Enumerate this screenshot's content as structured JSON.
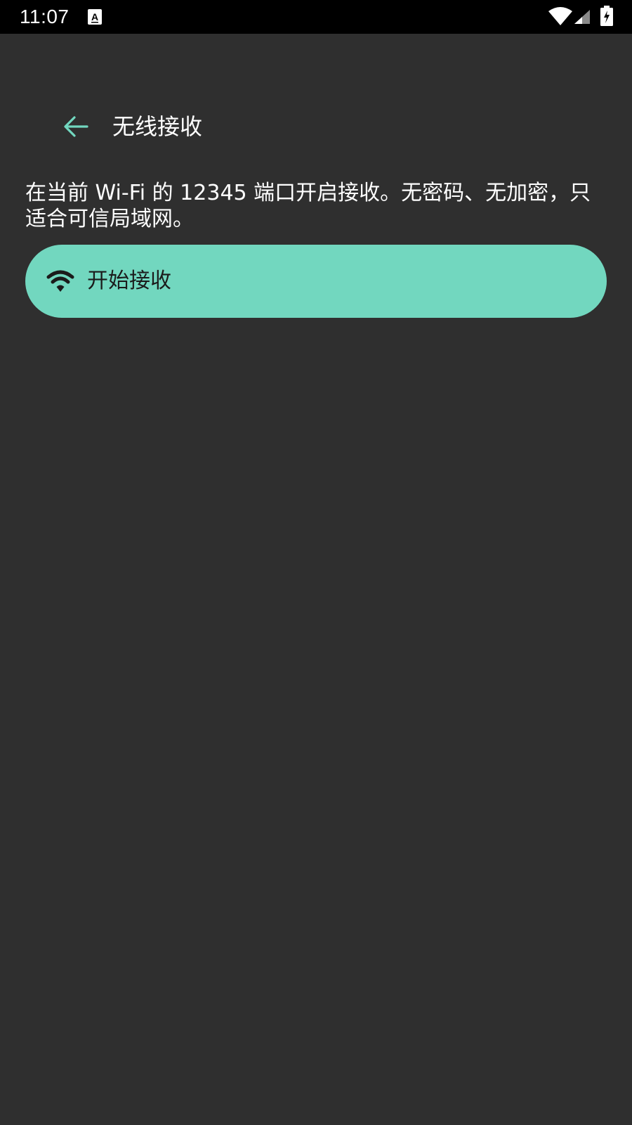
{
  "status_bar": {
    "time": "11:07",
    "icons": [
      "notification-a-icon",
      "wifi-icon",
      "cell-signal-icon",
      "battery-charging-icon"
    ]
  },
  "app_bar": {
    "back_icon": "arrow-back-icon",
    "title": "无线接收"
  },
  "main": {
    "description": "在当前 Wi-Fi 的 12345 端口开启接收。无密码、无加密，只适合可信局域网。",
    "start_button": {
      "icon": "wifi-icon",
      "label": "开始接收"
    }
  },
  "colors": {
    "background": "#2f2f2f",
    "status_bar": "#000000",
    "accent": "#72d7bf",
    "text_primary": "#ffffff",
    "button_text": "#1b1b1b"
  }
}
